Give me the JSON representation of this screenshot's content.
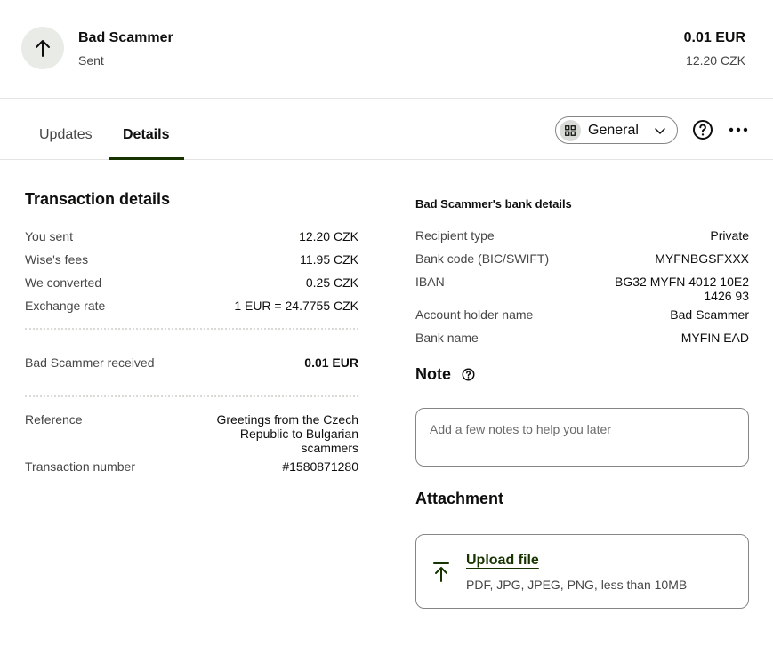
{
  "header": {
    "recipient_name": "Bad Scammer",
    "status": "Sent",
    "amount": "0.01 EUR",
    "amount_secondary": "12.20 CZK",
    "avatar_icon": "arrow-up-icon"
  },
  "tabs": [
    {
      "label": "Updates",
      "active": false
    },
    {
      "label": "Details",
      "active": true
    }
  ],
  "toolbar": {
    "view_select": "General",
    "view_icon": "grid-icon",
    "help_icon": "question-circle-icon",
    "more_icon": "more-horizontal-icon"
  },
  "transaction": {
    "title": "Transaction details",
    "rows": [
      {
        "label": "You sent",
        "value": "12.20 CZK"
      },
      {
        "label": "Wise's fees",
        "value": "11.95 CZK"
      },
      {
        "label": "We converted",
        "value": "0.25 CZK"
      },
      {
        "label": "Exchange rate",
        "value": "1 EUR = 24.7755 CZK"
      }
    ],
    "received_label": "Bad Scammer received",
    "received_value": "0.01 EUR",
    "reference_label": "Reference",
    "reference_value": [
      "Greetings from the Czech",
      "Republic to Bulgarian",
      "scammers"
    ],
    "txn_number_label": "Transaction number",
    "txn_number_value": "#1580871280"
  },
  "bank": {
    "title": "Bad Scammer's bank details",
    "rows": [
      {
        "label": "Recipient type",
        "value": "Private"
      },
      {
        "label": "Bank code (BIC/SWIFT)",
        "value": "MYFNBGSFXXX"
      },
      {
        "label": "IBAN",
        "value": [
          "BG32 MYFN 4012 10E2",
          "1426 93"
        ]
      },
      {
        "label": "Account holder name",
        "value": "Bad Scammer"
      },
      {
        "label": "Bank name",
        "value": "MYFIN EAD"
      }
    ]
  },
  "note": {
    "title": "Note",
    "placeholder": "Add a few notes to help you later"
  },
  "attachment": {
    "title": "Attachment",
    "upload_label": "Upload file",
    "upload_hint": "PDF, JPG, JPEG, PNG, less than 10MB"
  },
  "colors": {
    "accent": "#163300",
    "text": "#0e0f0c",
    "muted": "#454745",
    "border": "#e3e5e2"
  }
}
